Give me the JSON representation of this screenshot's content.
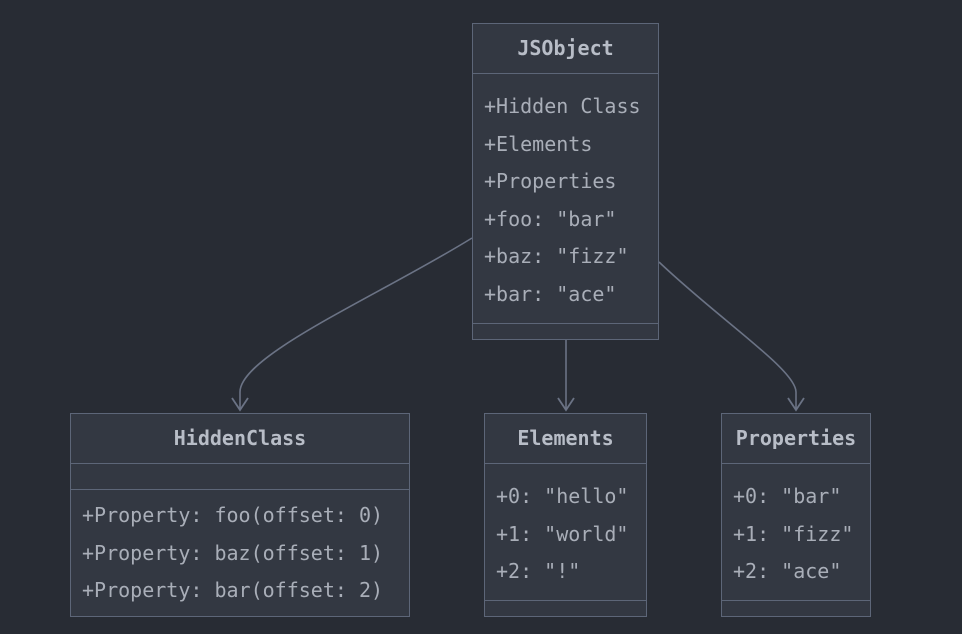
{
  "classes": {
    "jsobject": {
      "name": "JSObject",
      "attributes": [
        "+Hidden Class",
        "+Elements",
        "+Properties",
        "+foo: \"bar\"",
        "+baz: \"fizz\"",
        "+bar: \"ace\""
      ],
      "methods": []
    },
    "hiddenclass": {
      "name": "HiddenClass",
      "attributes": [],
      "methods": [
        "+Property: foo(offset: 0)",
        "+Property: baz(offset: 1)",
        "+Property: bar(offset: 2)"
      ]
    },
    "elements": {
      "name": "Elements",
      "attributes": [
        "+0: \"hello\"",
        "+1: \"world\"",
        "+2: \"!\""
      ],
      "methods": []
    },
    "properties": {
      "name": "Properties",
      "attributes": [
        "+0: \"bar\"",
        "+1: \"fizz\"",
        "+2: \"ace\""
      ],
      "methods": []
    }
  },
  "relations": [
    {
      "from": "JSObject",
      "to": "HiddenClass"
    },
    {
      "from": "JSObject",
      "to": "Elements"
    },
    {
      "from": "JSObject",
      "to": "Properties"
    }
  ],
  "colors": {
    "background": "#282c34",
    "box_fill": "#333842",
    "border": "#5d6678",
    "title_text": "#b8bdc7",
    "member_text": "#a9aeb8",
    "edge": "#6b7385"
  }
}
